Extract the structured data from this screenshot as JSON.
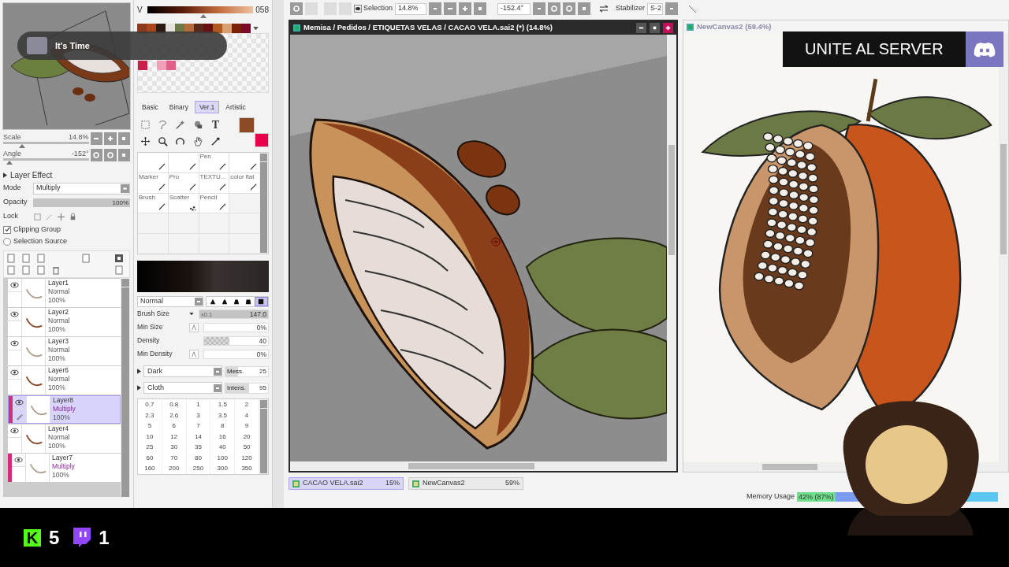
{
  "navigator": {
    "scale": {
      "label": "Scale",
      "value": "14.8%",
      "level": 0.22
    },
    "angle": {
      "label": "Angle",
      "value": "-152°",
      "level": 0.07
    }
  },
  "notification": {
    "title": "It's Time"
  },
  "color_slider": {
    "channel": "V",
    "value": "058",
    "level": 0.53
  },
  "swatches": [
    {
      "color": "#8b3a1a"
    },
    {
      "color": "#a8461c"
    },
    {
      "color": "#2a1a12"
    },
    {
      "color": "#e8e2dc"
    },
    {
      "color": "#6b7a45"
    },
    {
      "color": "#b86a3a"
    },
    {
      "color": "#5a2a18"
    },
    {
      "color": "#6a1010"
    },
    {
      "color": "#b05a20"
    },
    {
      "color": "#d8a070"
    },
    {
      "color": "#7a2008"
    },
    {
      "color": "#7a0a2a"
    }
  ],
  "palette": [
    {
      "kind": "color",
      "color": "#c8204a"
    },
    {
      "kind": "empty"
    },
    {
      "kind": "color",
      "color": "#f0a0b8"
    },
    {
      "kind": "color",
      "color": "#e06088"
    }
  ],
  "tool_tabs": [
    {
      "label": "Basic",
      "selected": false
    },
    {
      "label": "Binary",
      "selected": false
    },
    {
      "label": "Ver.1",
      "selected": true
    },
    {
      "label": "Artistic",
      "selected": false
    }
  ],
  "tools": [
    {
      "kind": "select"
    },
    {
      "kind": "lasso"
    },
    {
      "kind": "wand"
    },
    {
      "kind": "fill"
    },
    {
      "kind": "text",
      "glyph": "T"
    },
    {
      "kind": "move"
    },
    {
      "kind": "zoom"
    },
    {
      "kind": "rotate"
    },
    {
      "kind": "hand"
    },
    {
      "kind": "eyedropper"
    }
  ],
  "current_colors": [
    {
      "color": "#8b4a24"
    },
    {
      "color": "#e8004a"
    }
  ],
  "brushes": [
    {
      "kind": "pen"
    },
    {
      "kind": "pen"
    },
    {
      "kind": "pen",
      "label": "Pen"
    },
    {
      "kind": "pen"
    },
    {
      "kind": "pen",
      "label": "Marker"
    },
    {
      "kind": "pen",
      "label": "Pro"
    },
    {
      "kind": "pen",
      "label": "TEXTU..."
    },
    {
      "kind": "pen",
      "label": "color flat"
    },
    {
      "kind": "pen",
      "label": "Brush"
    },
    {
      "kind": "scatter",
      "label": "Scatter"
    },
    {
      "kind": "pen",
      "label": "Pencil"
    }
  ],
  "brush_settings": {
    "blend_mode": "Normal",
    "tip_shapes": [
      {
        "selected": false
      },
      {
        "selected": false
      },
      {
        "selected": false
      },
      {
        "selected": false
      },
      {
        "selected": true
      }
    ],
    "size": {
      "label": "Brush Size",
      "multiplier": "x0.1",
      "value": "147.0",
      "level": 1
    },
    "min_size": {
      "label": "Min Size",
      "value": "0%",
      "level": 0
    },
    "density": {
      "label": "Density",
      "value": "40",
      "level": 0.4
    },
    "min_density": {
      "label": "Min Density",
      "value": "0%",
      "level": 0
    }
  },
  "textures": [
    {
      "name": "Dark",
      "param_label": "Mess.",
      "param": "25",
      "level": 0.29
    },
    {
      "name": "Cloth",
      "param_label": "Intens.",
      "param": "95",
      "level": 0.55
    }
  ],
  "size_presets": [
    "0.7",
    "0.8",
    "1",
    "1.5",
    "2",
    "2.3",
    "2.6",
    "3",
    "3.5",
    "4",
    "5",
    "6",
    "7",
    "8",
    "9",
    "10",
    "12",
    "14",
    "16",
    "20",
    "25",
    "30",
    "35",
    "40",
    "50",
    "60",
    "70",
    "80",
    "100",
    "120",
    "160",
    "200",
    "250",
    "300",
    "350"
  ],
  "layer_effect": {
    "title": "Layer Effect",
    "mode_label": "Mode",
    "mode": "Multiply",
    "opacity_label": "Opacity",
    "opacity": {
      "value": "100%",
      "level": 1
    },
    "lock_label": "Lock",
    "clipping_group": {
      "label": "Clipping Group",
      "checked": true
    },
    "selection_source": {
      "label": "Selection Source",
      "checked": false
    }
  },
  "layers": [
    {
      "name": "Layer1",
      "mode": "Normal",
      "opacity": "100%",
      "selected": false,
      "clipped": false
    },
    {
      "name": "Layer2",
      "mode": "Normal",
      "opacity": "100%",
      "selected": false,
      "clipped": false
    },
    {
      "name": "Layer3",
      "mode": "Normal",
      "opacity": "100%",
      "selected": false,
      "clipped": false
    },
    {
      "name": "Layer6",
      "mode": "Normal",
      "opacity": "100%",
      "selected": false,
      "clipped": false
    },
    {
      "name": "Layer8",
      "mode": "Multiply",
      "opacity": "100%",
      "selected": true,
      "clipped": true
    },
    {
      "name": "Layer4",
      "mode": "Normal",
      "opacity": "100%",
      "selected": false,
      "clipped": false
    },
    {
      "name": "Layer7",
      "mode": "Multiply",
      "opacity": "100%",
      "selected": false,
      "clipped": true
    }
  ],
  "toolbar": {
    "selection_label": "Selection",
    "zoom": "14.8%",
    "angle": "-152.4°",
    "stabilizer_label": "Stabilizer",
    "stabilizer": "S-2"
  },
  "windows": [
    {
      "title": "Memisa / Pedidos / ETIQUETAS VELAS / CACAO VELA.sai2 (*) (14.8%)",
      "active": true
    },
    {
      "title": "NewCanvas2 (59.4%)",
      "active": false
    }
  ],
  "overlay_banner": {
    "text": "UNITE AL SERVER"
  },
  "document_tabs": [
    {
      "name": "CACAO VELA.sai2",
      "zoom": "15%",
      "selected": true
    },
    {
      "name": "NewCanvas2",
      "zoom": "59%",
      "selected": false
    }
  ],
  "memory_usage": {
    "label": "Memory Usage",
    "value": "42% (87%)",
    "level": 0.42
  },
  "stream_stats": [
    {
      "kind": "kick",
      "glyph": "K",
      "count": "5"
    },
    {
      "kind": "twitch",
      "count": "1"
    }
  ]
}
